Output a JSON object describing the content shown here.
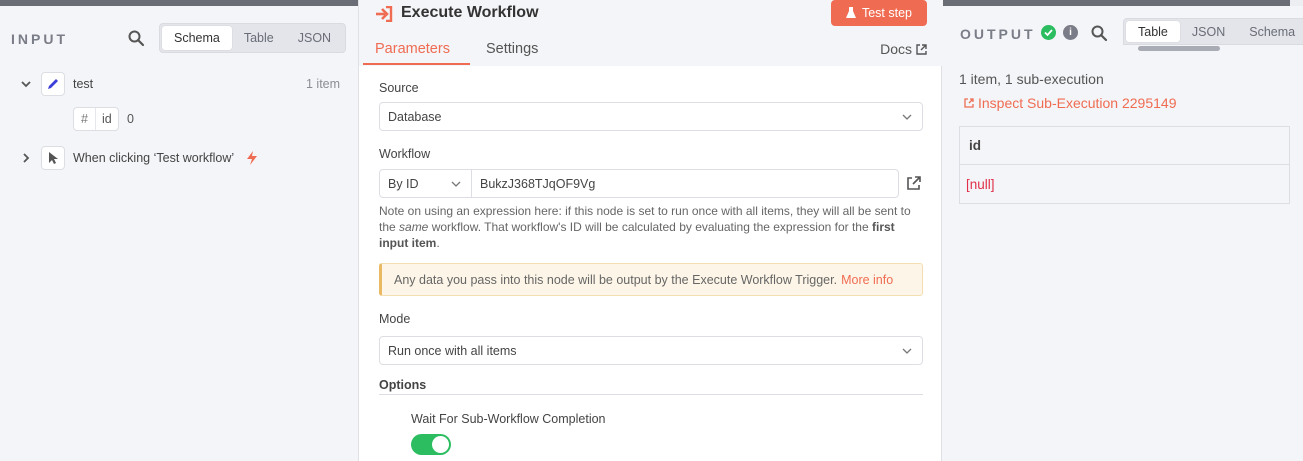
{
  "input": {
    "title": "INPUT",
    "view_tabs": [
      "Schema",
      "Table",
      "JSON"
    ],
    "nodes": [
      {
        "label": "test",
        "count": "1 item"
      },
      {
        "label": "When clicking ‘Test workflow’"
      }
    ],
    "field": {
      "hash": "#",
      "name": "id",
      "value": "0"
    }
  },
  "node": {
    "title": "Execute Workflow",
    "test_button": "Test step",
    "tabs": {
      "parameters": "Parameters",
      "settings": "Settings"
    },
    "docs": "Docs",
    "source_label": "Source",
    "source_value": "Database",
    "workflow_label": "Workflow",
    "workflow_mode": "By ID",
    "workflow_id": "BukzJ368TJqOF9Vg",
    "note_a": "Note on using an expression here: if this node is set to run once with all items, they will all be sent to the ",
    "note_same": "same",
    "note_b": " workflow. That workflow's ID will be calculated by evaluating the expression for the ",
    "note_first": "first input item",
    "note_c": ".",
    "callout": "Any data you pass into this node will be output by the Execute Workflow Trigger.",
    "callout_link": "More info",
    "mode_label": "Mode",
    "mode_value": "Run once with all items",
    "options_label": "Options",
    "wait_label": "Wait For Sub-Workflow Completion"
  },
  "output": {
    "title": "OUTPUT",
    "info": "i",
    "view_tabs": [
      "Table",
      "JSON",
      "Schema"
    ],
    "summary": "1 item, 1 sub-execution",
    "inspect": "Inspect Sub-Execution 2295149",
    "column": "id",
    "cell": "[null]"
  },
  "colors": {
    "accent": "#ef6c52",
    "success": "#2bbd5f",
    "null_text": "#e0304a"
  }
}
